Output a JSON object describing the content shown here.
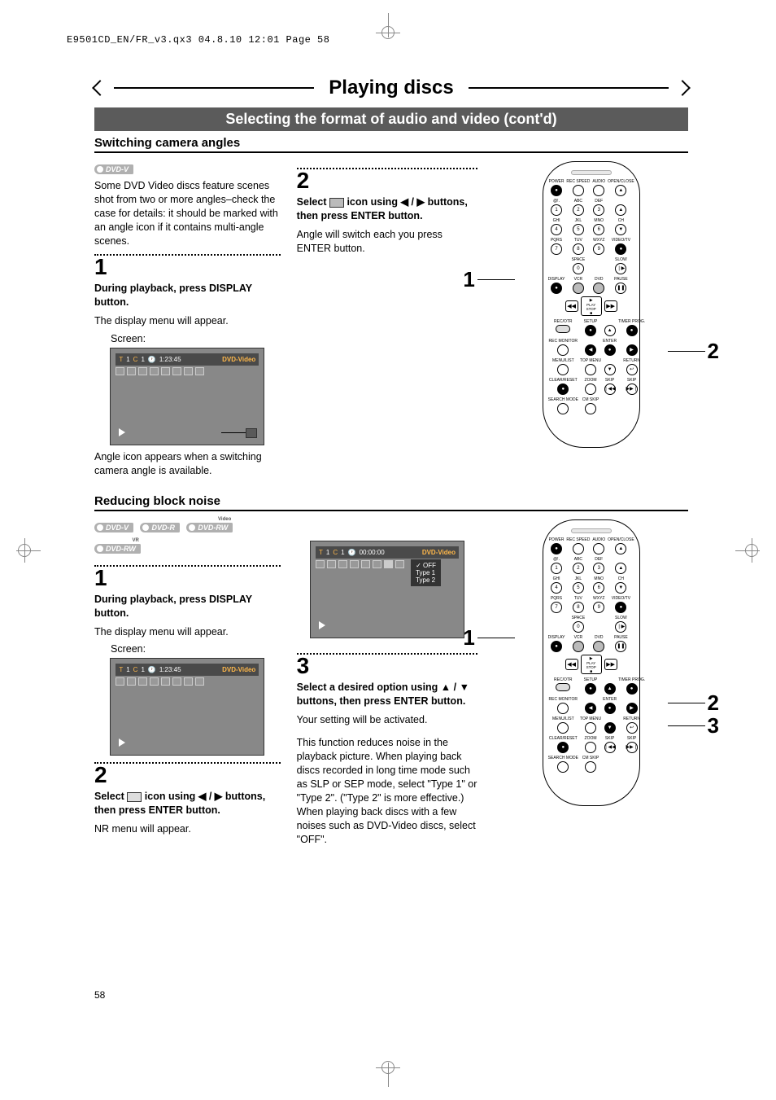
{
  "print_header": "E9501CD_EN/FR_v3.qx3  04.8.10  12:01  Page 58",
  "page_title": "Playing discs",
  "subtitle": "Selecting the format of audio and video (cont'd)",
  "section1_heading": "Switching camera angles",
  "dvd_badges": {
    "dvdv": "DVD-V",
    "dvdr": "DVD-R",
    "dvdrw_video": "DVD-RW",
    "dvdrw_video_sup": "Video",
    "dvdrw_vr": "DVD-RW",
    "dvdrw_vr_sup": "VR"
  },
  "section1": {
    "intro": "Some DVD Video discs feature scenes shot from two or more angles–check the case for details: it should be marked with an angle icon if it contains multi-angle scenes.",
    "step1_num": "1",
    "step1_head": "During playback, press DISPLAY button.",
    "step1_body": "The display menu will appear.",
    "screen_label": "Screen:",
    "angle_note": "Angle icon appears when a switching camera angle is available.",
    "step2_num": "2",
    "step2_pre": "Select ",
    "step2_icon_name": "camera-angle-icon",
    "step2_mid": " icon using ",
    "step2_arrows": "◀ / ▶",
    "step2_post": " buttons, then press ENTER button.",
    "step2_body": "Angle will switch each you press ENTER button."
  },
  "osd1": {
    "t": "T",
    "t_val": "1",
    "c": "C",
    "c_val": "1",
    "clock": "🕐",
    "time": "1:23:45",
    "label": "DVD-Video"
  },
  "section2_heading": "Reducing block noise",
  "section2": {
    "step1_num": "1",
    "step1_head": "During playback, press DISPLAY button.",
    "step1_body": "The display menu will appear.",
    "screen_label": "Screen:",
    "step2_num": "2",
    "step2_pre": "Select ",
    "step2_icon_name": "nr-icon",
    "step2_mid": " icon using ",
    "step2_arrows": "◀ / ▶",
    "step2_post": " buttons, then press ENTER button.",
    "step2_body": "NR menu will appear.",
    "step3_num": "3",
    "step3_head_pre": "Select a desired option using ",
    "step3_arrows": "▲ / ▼",
    "step3_head_post": " buttons, then press ENTER button.",
    "step3_body1": "Your setting will be activated.",
    "step3_body2": "This function reduces noise in the playback picture. When playing back discs recorded in long time mode such as SLP or SEP mode, select \"Type 1\" or \"Type 2\". (\"Type 2\" is more effective.) When playing back discs with a few noises such as DVD-Video discs, select \"OFF\"."
  },
  "osd3": {
    "time": "00:00:00",
    "label": "DVD-Video",
    "opt_off": "OFF",
    "opt_t1": "Type 1",
    "opt_t2": "Type 2"
  },
  "remote": {
    "POWER": "POWER",
    "REC_SPEED": "REC SPEED",
    "AUDIO": "AUDIO",
    "OPEN_CLOSE": "OPEN/CLOSE",
    "ABC": "ABC",
    "DEF": "DEF",
    "GHI": "GHI",
    "JKL": "JKL",
    "MNO": "MNO",
    "CH": "CH",
    "PQRS": "PQRS",
    "TUV": "TUV",
    "WXYZ": "WXYZ",
    "VIDEO_TV": "VIDEO/TV",
    "SPACE": "SPACE",
    "SLOW": "SLOW",
    "DISPLAY": "DISPLAY",
    "VCR": "VCR",
    "DVD": "DVD",
    "PAUSE": "PAUSE",
    "PLAY": "PLAY",
    "STOP": "STOP",
    "REC_OTR": "REC/OTR",
    "SETUP": "SETUP",
    "TIMER_PROG": "TIMER PROG.",
    "REC_MONITOR": "REC MONITOR",
    "ENTER": "ENTER",
    "MENU_LIST": "MENU/LIST",
    "TOP_MENU": "TOP MENU",
    "RETURN": "RETURN",
    "CLEAR_RESET": "CLEAR/RESET",
    "ZOOM": "ZOOM",
    "SKIP": "SKIP",
    "SKIP2": "SKIP",
    "SEARCH_MODE": "SEARCH MODE",
    "CM_SKIP": "CM SKIP",
    "n1": "1",
    "n2": "2",
    "n3": "3",
    "n4": "4",
    "n5": "5",
    "n6": "6",
    "n7": "7",
    "n8": "8",
    "n9": "9",
    "n0": "0",
    "up": "▲",
    "down": "▼",
    "left": "◀",
    "right": "▶",
    "eject": "▲",
    "pause": "❚❚",
    "slowf": "❘▶",
    "rew": "◀◀",
    "ff": "▶▶",
    "pskip": "❘◀◀",
    "nskip": "▶▶❘",
    "dot": "●"
  },
  "remote_callouts": {
    "c1": "1",
    "c2": "2",
    "c3": "3"
  },
  "page_number": "58"
}
